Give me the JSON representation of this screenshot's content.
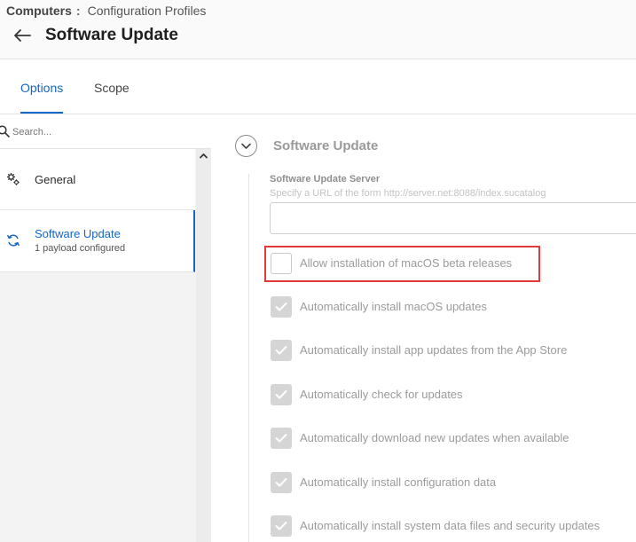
{
  "breadcrumb": {
    "first": "Computers",
    "separator": ":",
    "current": "Configuration Profiles"
  },
  "page": {
    "title": "Software Update"
  },
  "tabs": [
    {
      "label": "Options",
      "active": true
    },
    {
      "label": "Scope",
      "active": false
    }
  ],
  "sidebar": {
    "search_placeholder": "Search...",
    "items": [
      {
        "label": "General",
        "icon": "gears-icon"
      },
      {
        "label": "Software Update",
        "sublabel": "1 payload configured",
        "icon": "sync-icon",
        "selected": true
      }
    ]
  },
  "section": {
    "title": "Software Update",
    "server_label": "Software Update Server",
    "server_hint": "Specify a URL of the form http://server.net:8088/index.sucatalog",
    "server_value": ""
  },
  "options": [
    {
      "label": "Allow installation of macOS beta releases",
      "checked": false
    },
    {
      "label": "Automatically install macOS updates",
      "checked": true
    },
    {
      "label": "Automatically install app updates from the App Store",
      "checked": true
    },
    {
      "label": "Automatically check for updates",
      "checked": true
    },
    {
      "label": "Automatically download new updates when available",
      "checked": true
    },
    {
      "label": "Automatically install configuration data",
      "checked": true
    },
    {
      "label": "Automatically install system data files and security updates",
      "checked": true
    }
  ],
  "colors": {
    "accent": "#1466c7",
    "highlight": "#e23a3a",
    "disabled_text": "#9b9b9b"
  }
}
